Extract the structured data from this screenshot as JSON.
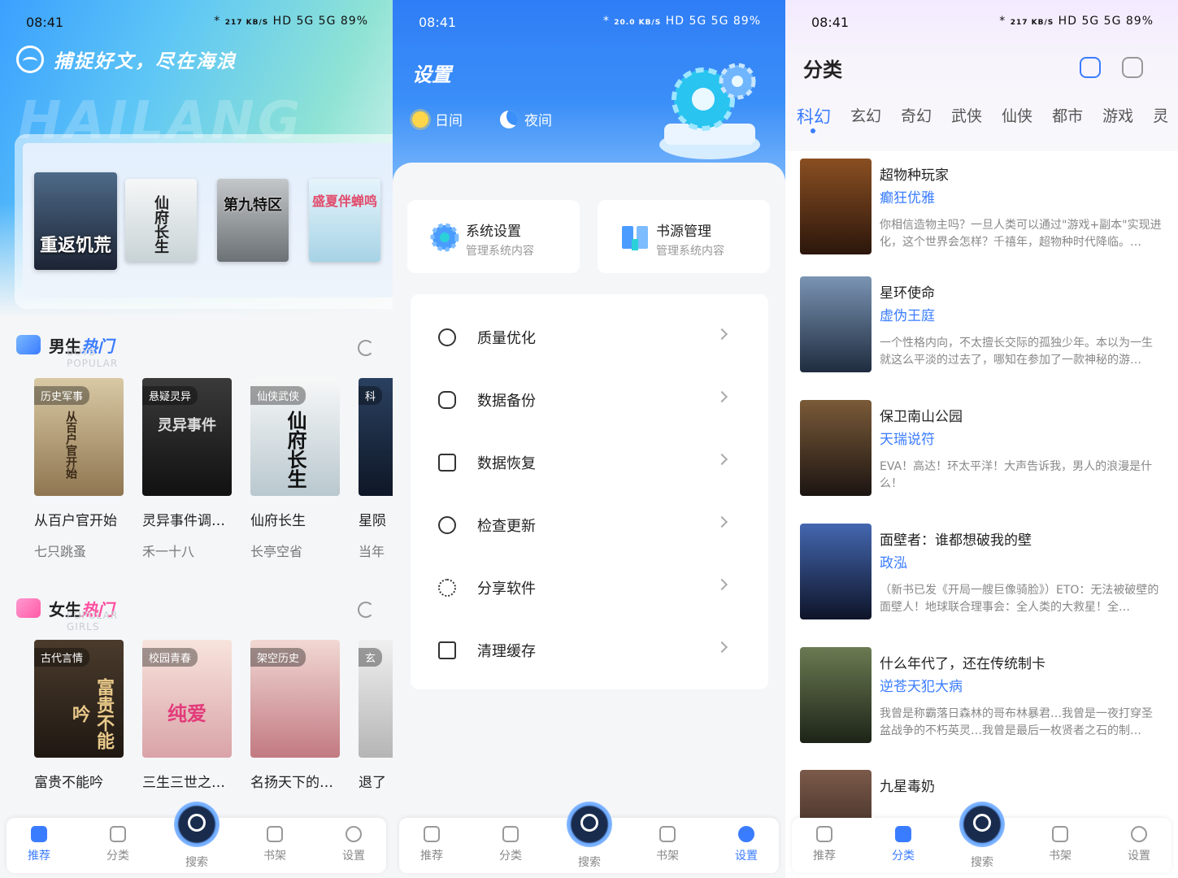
{
  "status": {
    "time": "08:41",
    "icons": [
      "*",
      "217 KB/S",
      "HD",
      "5G",
      "5G",
      "89%"
    ],
    "icons_s2": [
      "*",
      "20.0 KB/S",
      "HD",
      "5G",
      "5G",
      "89%"
    ]
  },
  "screen1": {
    "watermark": "HAILANG",
    "slogan": "捕捉好文，尽在海浪",
    "banner_covers": [
      {
        "text": "重返饥荒",
        "color": "#2d3b52"
      },
      {
        "text": "仙府长生",
        "color": "#e8edf0"
      },
      {
        "text": "第九特区",
        "color": "#8a8f92"
      },
      {
        "text": "盛夏伴蝉鸣",
        "color": "#bfe2f0"
      }
    ],
    "boys": {
      "title_a": "男生",
      "title_b": "热门",
      "sub": "BOYS POPULAR",
      "books": [
        {
          "tag": "历史军事",
          "cover_text": "从百户官开始",
          "title": "从百户官开始",
          "author": "七只跳蚤",
          "color": "#b59b72"
        },
        {
          "tag": "悬疑灵异",
          "cover_text": "灵异事件",
          "title": "灵异事件调…",
          "author": "禾一十八",
          "color": "#2b2b2b"
        },
        {
          "tag": "仙侠武侠",
          "cover_text": "仙府长生",
          "title": "仙府长生",
          "author": "长亭空省",
          "color": "#eef1f3"
        },
        {
          "tag": "科",
          "cover_text": "",
          "title": "星陨",
          "author": "当年",
          "color": "#1d2f4a"
        }
      ]
    },
    "girls": {
      "title_a": "女生",
      "title_b": "热门",
      "sub": "POPULAR GIRLS",
      "books": [
        {
          "tag": "古代言情",
          "cover_text": "富贵不能吟",
          "title": "富贵不能吟",
          "author": "",
          "color": "#3b3026"
        },
        {
          "tag": "校园青春",
          "cover_text": "纯爱",
          "title": "三生三世之…",
          "author": "",
          "color": "#f3d9d3"
        },
        {
          "tag": "架空历史",
          "cover_text": "",
          "title": "名扬天下的…",
          "author": "",
          "color": "#e8c6c2"
        },
        {
          "tag": "玄",
          "cover_text": "",
          "title": "退了",
          "author": "",
          "color": "#dadada"
        }
      ]
    }
  },
  "screen2": {
    "title": "设置",
    "day": "日间",
    "night": "夜间",
    "cards": [
      {
        "title": "系统设置",
        "sub": "管理系统内容"
      },
      {
        "title": "书源管理",
        "sub": "管理系统内容"
      }
    ],
    "menu": [
      "质量优化",
      "数据备份",
      "数据恢复",
      "检查更新",
      "分享软件",
      "清理缓存"
    ]
  },
  "screen3": {
    "title": "分类",
    "tabs": [
      "科幻",
      "玄幻",
      "奇幻",
      "武侠",
      "仙侠",
      "都市",
      "游戏",
      "灵"
    ],
    "books": [
      {
        "title": "超物种玩家",
        "author": "癫狂优雅",
        "desc": "你相信造物主吗？一旦人类可以通过\"游戏+副本\"实现进化，这个世界会怎样？千禧年，超物种时代降临。…",
        "color": "#6a3a1e"
      },
      {
        "title": "星环使命",
        "author": "虚伪王庭",
        "desc": "一个性格内向，不太擅长交际的孤独少年。本以为一生就这么平淡的过去了，哪知在参加了一款神秘的游…",
        "color": "#3a4f6a"
      },
      {
        "title": "保卫南山公园",
        "author": "天瑞说符",
        "desc": "EVA！高达！环太平洋！大声告诉我，男人的浪漫是什么！",
        "color": "#3b3030"
      },
      {
        "title": "面壁者：谁都想破我的壁",
        "author": "政泓",
        "desc": "（新书已发《开局一艘巨像骑脸》）ETO：无法被破壁的面壁人！地球联合理事会：全人类的大救星！全…",
        "color": "#1c2c4c"
      },
      {
        "title": "什么年代了，还在传统制卡",
        "author": "逆苍天犯大病",
        "desc": "我曾是称霸落日森林的哥布林暴君…我曾是一夜打穿圣盆战争的不朽英灵…我曾是最后一枚贤者之石的制…",
        "color": "#3a4630"
      },
      {
        "title": "九星毒奶",
        "author": "",
        "desc": "",
        "color": "#4a3a32"
      }
    ]
  },
  "nav": {
    "items": [
      "推荐",
      "分类",
      "搜索",
      "书架",
      "设置"
    ]
  }
}
